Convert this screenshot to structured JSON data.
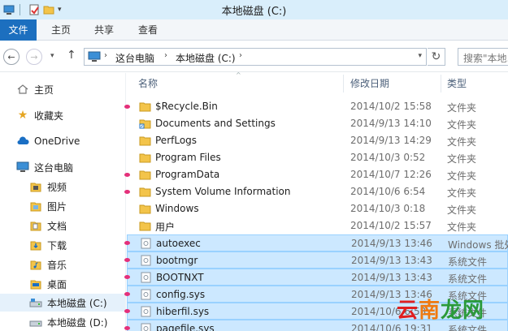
{
  "window": {
    "title": "本地磁盘 (C:)"
  },
  "ribbon": {
    "tabs": [
      "文件",
      "主页",
      "共享",
      "查看"
    ]
  },
  "address": {
    "crumbs": [
      "这台电脑",
      "本地磁盘 (C:)"
    ],
    "search_placeholder": "搜索\"本地..."
  },
  "nav": {
    "items": [
      {
        "label": "主页",
        "icon": "home-icon"
      },
      {
        "label": "收藏夹",
        "icon": "star-icon"
      },
      {
        "label": "OneDrive",
        "icon": "cloud-icon"
      },
      {
        "label": "这台电脑",
        "icon": "computer-icon"
      },
      {
        "label": "视频",
        "icon": "video-folder-icon"
      },
      {
        "label": "图片",
        "icon": "pictures-folder-icon"
      },
      {
        "label": "文档",
        "icon": "documents-folder-icon"
      },
      {
        "label": "下载",
        "icon": "downloads-folder-icon"
      },
      {
        "label": "音乐",
        "icon": "music-folder-icon"
      },
      {
        "label": "桌面",
        "icon": "desktop-folder-icon"
      },
      {
        "label": "本地磁盘 (C:)",
        "icon": "drive-icon"
      },
      {
        "label": "本地磁盘 (D:)",
        "icon": "drive-icon"
      }
    ]
  },
  "columns": {
    "name": "名称",
    "date": "修改日期",
    "type": "类型"
  },
  "files": [
    {
      "name": "$Recycle.Bin",
      "date": "2014/10/2 15:58",
      "type": "文件夹",
      "kind": "folder"
    },
    {
      "name": "Documents and Settings",
      "date": "2014/9/13 14:10",
      "type": "文件夹",
      "kind": "shortcut-folder"
    },
    {
      "name": "PerfLogs",
      "date": "2014/9/13 14:29",
      "type": "文件夹",
      "kind": "folder"
    },
    {
      "name": "Program Files",
      "date": "2014/10/3 0:52",
      "type": "文件夹",
      "kind": "folder"
    },
    {
      "name": "ProgramData",
      "date": "2014/10/7 12:26",
      "type": "文件夹",
      "kind": "folder"
    },
    {
      "name": "System Volume Information",
      "date": "2014/10/6 6:54",
      "type": "文件夹",
      "kind": "folder"
    },
    {
      "name": "Windows",
      "date": "2014/10/3 0:18",
      "type": "文件夹",
      "kind": "folder"
    },
    {
      "name": "用户",
      "date": "2014/10/2 15:57",
      "type": "文件夹",
      "kind": "folder"
    },
    {
      "name": "autoexec",
      "date": "2014/9/13 13:46",
      "type": "Windows 批处",
      "kind": "system-file"
    },
    {
      "name": "bootmgr",
      "date": "2014/9/13 13:43",
      "type": "系统文件",
      "kind": "system-file"
    },
    {
      "name": "BOOTNXT",
      "date": "2014/9/13 13:43",
      "type": "系统文件",
      "kind": "system-file"
    },
    {
      "name": "config.sys",
      "date": "2014/9/13 13:46",
      "type": "系统文件",
      "kind": "system-file"
    },
    {
      "name": "hiberfil.sys",
      "date": "2014/10/6 6:53",
      "type": "系统文件",
      "kind": "system-file"
    },
    {
      "name": "pagefile.sys",
      "date": "2014/10/6 19:31",
      "type": "系统文件",
      "kind": "system-file"
    }
  ],
  "watermark": {
    "part1": "云",
    "part2": "南",
    "part3": "龙网"
  }
}
